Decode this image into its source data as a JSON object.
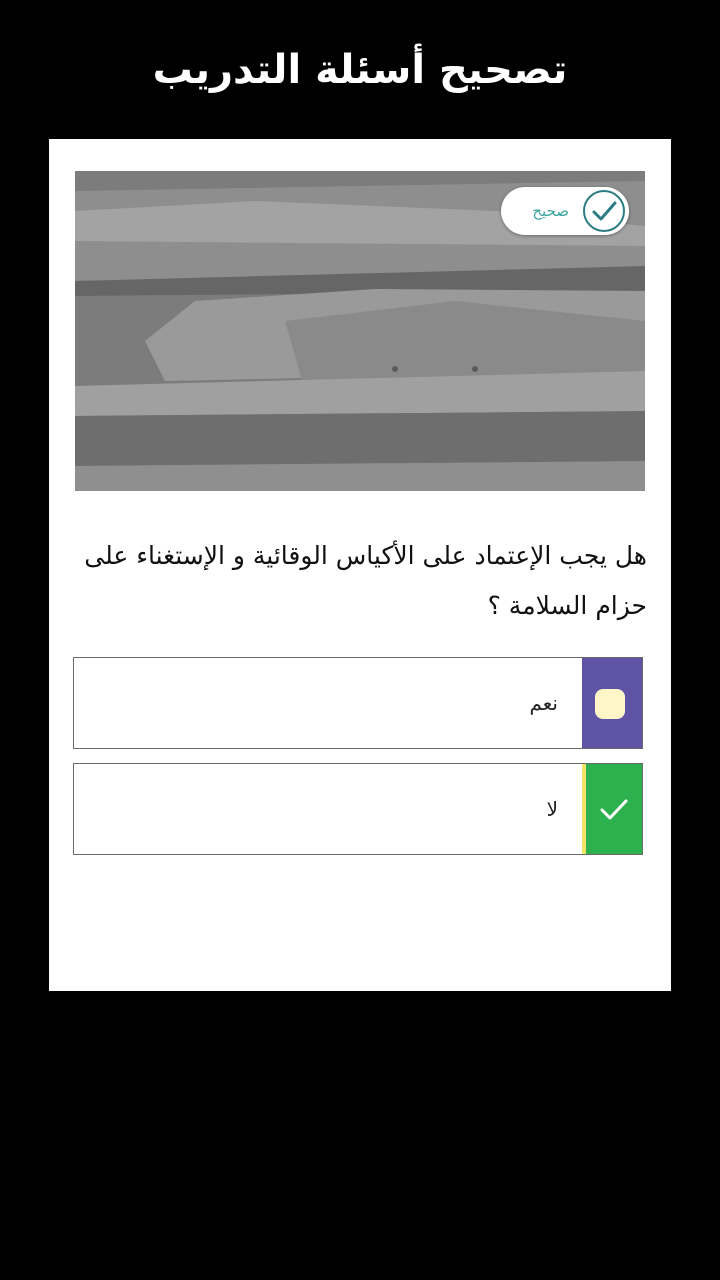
{
  "header": {
    "title": "تصحيح أسئلة التدريب"
  },
  "question_card": {
    "image_badge": {
      "label": "صحيح",
      "icon": "check-circle-icon"
    },
    "question_text": "هل يجب الإعتماد على الأكياس الوقائية و الإستغناء على حزام السلامة ؟",
    "options": [
      {
        "label": "نعم",
        "state": "unselected",
        "marker_color": "#5f53a6"
      },
      {
        "label": "لا",
        "state": "correct",
        "marker_color": "#2db14e",
        "icon": "check-icon"
      }
    ]
  },
  "colors": {
    "background": "#000000",
    "card": "#ffffff",
    "correct": "#2db14e",
    "option_accent": "#5f53a6"
  }
}
